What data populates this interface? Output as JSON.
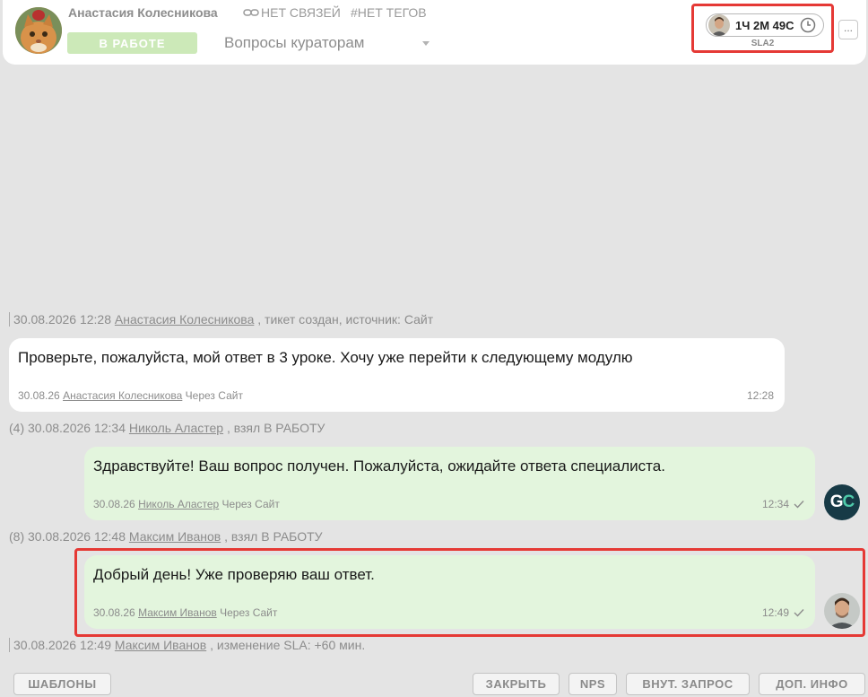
{
  "header": {
    "client_name": "Анастасия Колесникова",
    "links": "НЕТ СВЯЗЕЙ",
    "tags": "#НЕТ ТЕГОВ",
    "status": "В РАБОТЕ",
    "queue": "Вопросы кураторам",
    "sla_time": "1Ч 2М 49С",
    "sla_label": "SLA2",
    "more_label": "..."
  },
  "events": {
    "created": {
      "datetime": "30.08.2026 12:28",
      "author": "Анастасия Колесникова",
      "action": ", тикет создан, источник: Сайт"
    },
    "assigned1": {
      "prefix": "(4) 30.08.2026 12:34",
      "author": "Николь Аластер",
      "action": ", взял В РАБОТУ"
    },
    "assigned2": {
      "prefix": "(8) 30.08.2026 12:48",
      "author": "Максим Иванов",
      "action": ", взял В РАБОТУ"
    },
    "sla_change": {
      "datetime": "30.08.2026 12:49",
      "author": "Максим Иванов",
      "action": ", изменение SLA: +60 мин."
    }
  },
  "messages": [
    {
      "text": "Проверьте, пожалуйста, мой ответ в 3 уроке. Хочу уже перейти к следующему модулю",
      "date": "30.08.26",
      "author": "Анастасия Колесникова",
      "via": "Через Сайт",
      "time": "12:28"
    },
    {
      "text": "Здравствуйте! Ваш вопрос получен. Пожалуйста, ожидайте ответа специалиста.",
      "date": "30.08.26",
      "author": "Николь Аластер",
      "via": "Через Сайт",
      "time": "12:34"
    },
    {
      "text": "Добрый день! Уже проверяю ваш ответ.",
      "date": "30.08.26",
      "author": "Максим Иванов",
      "via": "Через Сайт",
      "time": "12:49"
    }
  ],
  "avatars": {
    "gc_g": "G",
    "gc_c": "C"
  },
  "footer": {
    "templates": "ШАБЛОНЫ",
    "close": "ЗАКРЫТЬ",
    "nps": "NPS",
    "internal_request": "ВНУТ. ЗАПРОС",
    "extra_info": "ДОП. ИНФО"
  },
  "colors": {
    "background": "#e4e4e4",
    "status_green": "#cce9b8",
    "agent_bubble": "#e3f5dd",
    "highlight_red": "#e53935",
    "gc_avatar_bg": "#173a46",
    "gc_accent": "#4ec9a9"
  }
}
